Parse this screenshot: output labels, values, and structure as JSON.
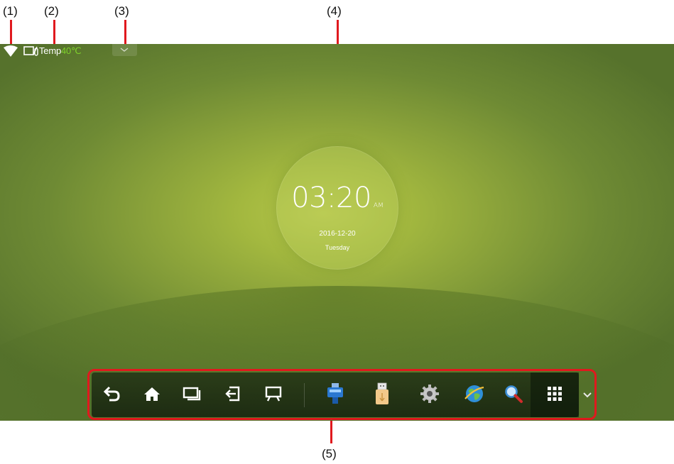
{
  "callouts": {
    "c1": "(1)",
    "c2": "(2)",
    "c3": "(3)",
    "c4": "(4)",
    "c5": "(5)"
  },
  "status": {
    "temp_label": "Temp",
    "temp_value": "40℃",
    "wifi_icon": "wifi-icon",
    "temp_icon": "thermometer-icon"
  },
  "clock": {
    "time": "03:20",
    "ampm": "AM",
    "date": "2016-12-20",
    "day": "Tuesday"
  },
  "toolbar": {
    "items": [
      {
        "name": "back",
        "icon": "back-arrow-icon"
      },
      {
        "name": "home",
        "icon": "home-icon"
      },
      {
        "name": "recent",
        "icon": "recent-windows-icon"
      },
      {
        "name": "input-source",
        "icon": "input-source-icon"
      },
      {
        "name": "whiteboard",
        "icon": "whiteboard-icon"
      },
      {
        "name": "hdmi",
        "icon": "hdmi-icon"
      },
      {
        "name": "usb",
        "icon": "usb-icon"
      },
      {
        "name": "settings",
        "icon": "gear-icon"
      },
      {
        "name": "browser",
        "icon": "globe-icon"
      },
      {
        "name": "search",
        "icon": "search-icon"
      },
      {
        "name": "apps",
        "icon": "apps-grid-icon"
      }
    ],
    "collapse_icon": "chevron-down-icon"
  },
  "colors": {
    "accent_red": "#e0191e",
    "temp_green": "#7fd12c"
  }
}
